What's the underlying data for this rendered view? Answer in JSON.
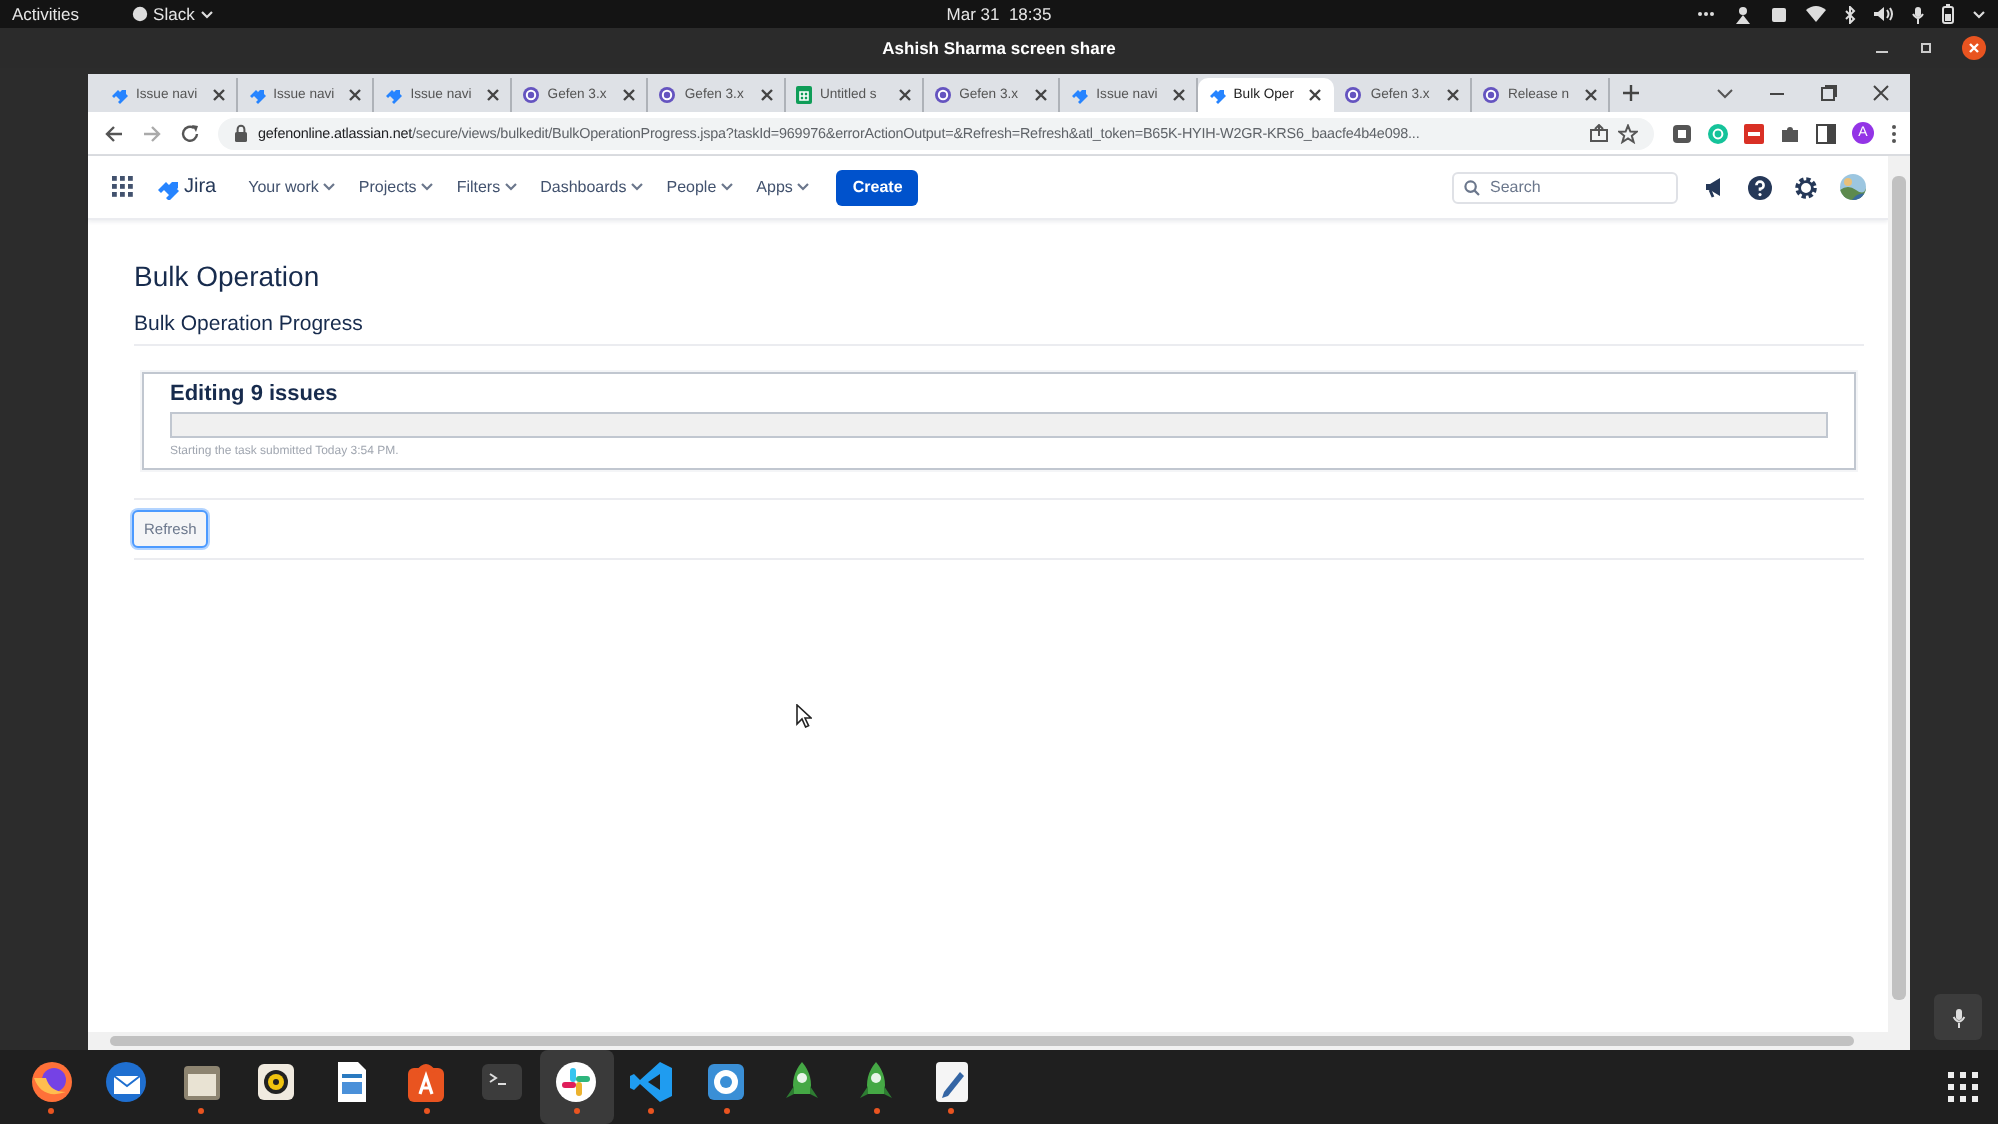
{
  "top_bar": {
    "activities": "Activities",
    "app_menu": "Slack",
    "clock": "Mar 31  18:35"
  },
  "share_bar": {
    "title": "Ashish Sharma screen share"
  },
  "browser": {
    "tabs": [
      {
        "kind": "jira",
        "title": "Issue navi",
        "selected": false
      },
      {
        "kind": "jira",
        "title": "Issue navi",
        "selected": false
      },
      {
        "kind": "jira",
        "title": "Issue navi",
        "selected": false
      },
      {
        "kind": "ring",
        "title": "Gefen 3.x",
        "selected": false
      },
      {
        "kind": "ring",
        "title": "Gefen 3.x",
        "selected": false
      },
      {
        "kind": "sheet",
        "title": "Untitled s",
        "selected": false
      },
      {
        "kind": "ring",
        "title": "Gefen 3.x",
        "selected": false
      },
      {
        "kind": "jira",
        "title": "Issue navi",
        "selected": false
      },
      {
        "kind": "jira",
        "title": "Bulk Oper",
        "selected": true
      },
      {
        "kind": "ring",
        "title": "Gefen 3.x",
        "selected": false
      },
      {
        "kind": "ring",
        "title": "Release n",
        "selected": false
      }
    ],
    "url_domain": "gefenonline.atlassian.net",
    "url_path": "/secure/views/bulkedit/BulkOperationProgress.jspa?taskId=969976&errorActionOutput=&Refresh=Refresh&atl_token=B65K-HYIH-W2GR-KRS6_baacfe4b4e098...",
    "avatar": "A"
  },
  "jira": {
    "product": "Jira",
    "nav": [
      {
        "label": "Your work"
      },
      {
        "label": "Projects"
      },
      {
        "label": "Filters"
      },
      {
        "label": "Dashboards"
      },
      {
        "label": "People"
      },
      {
        "label": "Apps"
      }
    ],
    "create": "Create",
    "search": {
      "placeholder": "Search"
    },
    "page_title": "Bulk Operation",
    "section": "Bulk Operation Progress",
    "task": {
      "title": "Editing 9 issues",
      "level": 0,
      "note": "Starting the task submitted Today 3:54 PM."
    },
    "refresh": "Refresh"
  },
  "dock": [
    {
      "kind": "firefox",
      "running": true,
      "focused": false
    },
    {
      "kind": "mail",
      "running": false,
      "focused": false
    },
    {
      "kind": "files",
      "running": true,
      "focused": false
    },
    {
      "kind": "music",
      "running": false,
      "focused": false
    },
    {
      "kind": "writer",
      "running": false,
      "focused": false
    },
    {
      "kind": "store",
      "running": true,
      "focused": false
    },
    {
      "kind": "terminal",
      "running": false,
      "focused": false
    },
    {
      "kind": "slack",
      "running": true,
      "focused": true
    },
    {
      "kind": "vscode",
      "running": true,
      "focused": false
    },
    {
      "kind": "aperture",
      "running": true,
      "focused": false
    },
    {
      "kind": "rocket",
      "running": false,
      "focused": false
    },
    {
      "kind": "rocket",
      "running": true,
      "focused": false
    },
    {
      "kind": "editor",
      "running": true,
      "focused": false
    }
  ]
}
